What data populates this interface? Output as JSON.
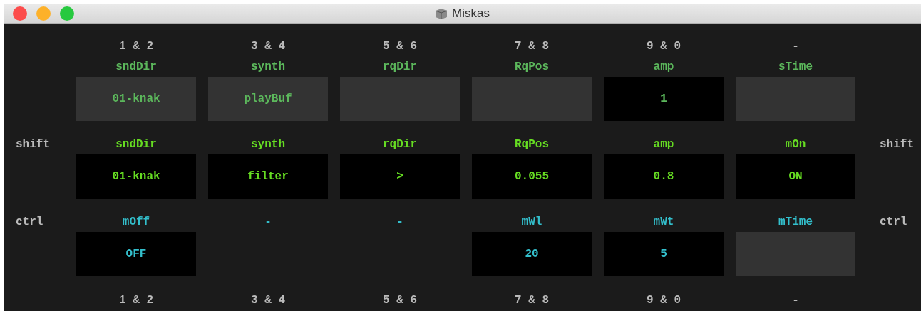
{
  "window": {
    "title": "Miskas"
  },
  "top_keys": [
    "1 & 2",
    "3 & 4",
    "5 & 6",
    "7 & 8",
    "9 & 0",
    "-"
  ],
  "rows": [
    {
      "color": "#5cb85c",
      "cells": [
        {
          "name": "sndDir",
          "kind": "dim",
          "value": "01-knak"
        },
        {
          "name": "synth",
          "kind": "dim",
          "value": "playBuf"
        },
        {
          "name": "rqDir",
          "kind": "dim"
        },
        {
          "name": "RqPos",
          "kind": "dim"
        },
        {
          "name": "amp",
          "kind": "value",
          "value": "1"
        },
        {
          "name": "sTime",
          "kind": "dim"
        }
      ]
    },
    {
      "modifier_left": "shift",
      "modifier_right": "shift",
      "color": "#66dd22",
      "cells": [
        {
          "name": "sndDir",
          "kind": "value",
          "value": "01-knak"
        },
        {
          "name": "synth",
          "kind": "value",
          "value": "filter"
        },
        {
          "name": "rqDir",
          "kind": "value",
          "value": ">"
        },
        {
          "name": "RqPos",
          "kind": "value",
          "value": "0.055"
        },
        {
          "name": "amp",
          "kind": "value",
          "value": "0.8"
        },
        {
          "name": "mOn",
          "kind": "value",
          "value": "ON"
        }
      ]
    },
    {
      "modifier_left": "ctrl",
      "modifier_right": "ctrl",
      "color": "#33bfcc",
      "cells": [
        {
          "name": "mOff",
          "kind": "value",
          "value": "OFF"
        },
        {
          "name": "-",
          "kind": "none"
        },
        {
          "name": "-",
          "kind": "none"
        },
        {
          "name": "mWl",
          "kind": "value",
          "value": "20"
        },
        {
          "name": "mWt",
          "kind": "value",
          "value": "5"
        },
        {
          "name": "mTime",
          "kind": "dim"
        }
      ]
    }
  ],
  "bottom_keys": [
    "1 & 2",
    "3 & 4",
    "5 & 6",
    "7 & 8",
    "9 & 0",
    "-"
  ]
}
